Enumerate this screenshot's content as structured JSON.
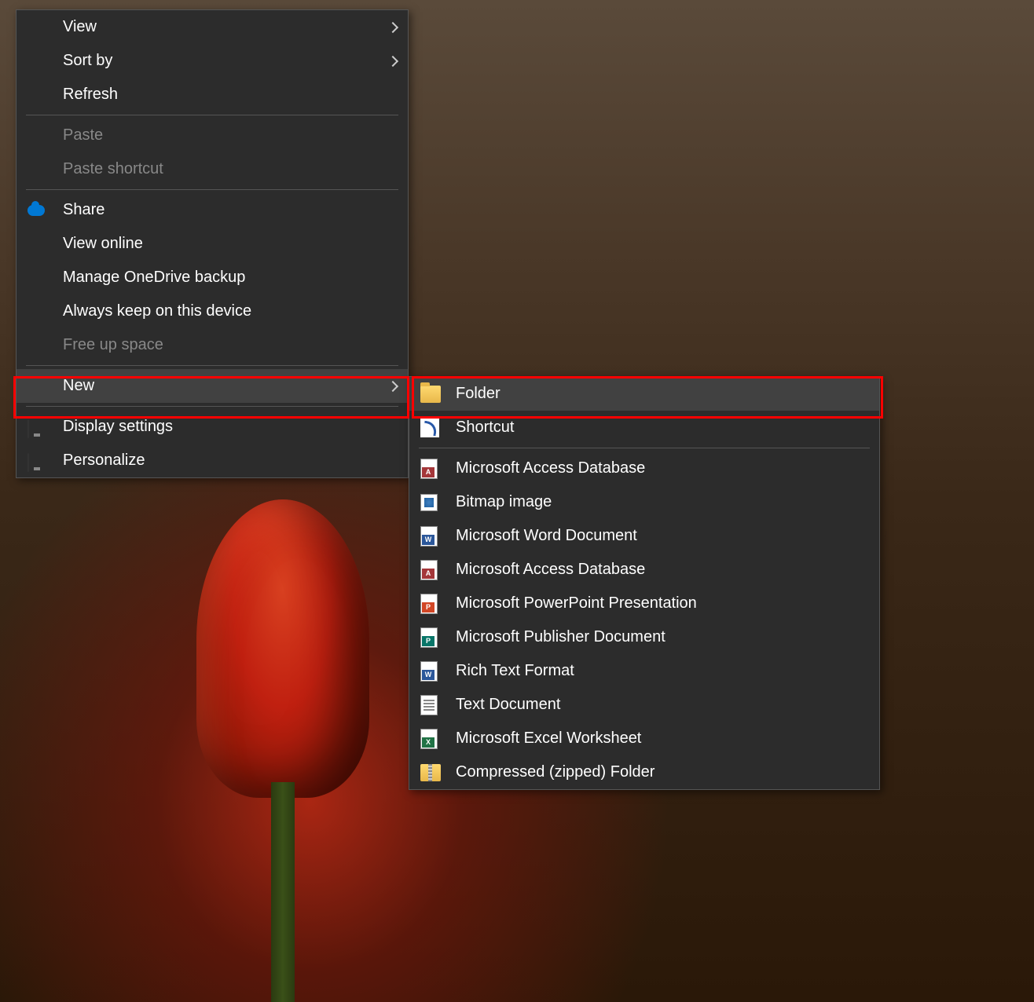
{
  "main_menu": {
    "items": [
      {
        "label": "View",
        "has_submenu": true,
        "disabled": false
      },
      {
        "label": "Sort by",
        "has_submenu": true,
        "disabled": false
      },
      {
        "label": "Refresh",
        "has_submenu": false,
        "disabled": false
      }
    ],
    "paste_items": [
      {
        "label": "Paste",
        "disabled": true
      },
      {
        "label": "Paste shortcut",
        "disabled": true
      }
    ],
    "onedrive_items": [
      {
        "label": "Share",
        "icon": "cloud",
        "disabled": false
      },
      {
        "label": "View online",
        "disabled": false
      },
      {
        "label": "Manage OneDrive backup",
        "disabled": false
      },
      {
        "label": "Always keep on this device",
        "disabled": false
      },
      {
        "label": "Free up space",
        "disabled": true
      }
    ],
    "new_item": {
      "label": "New",
      "has_submenu": true,
      "highlighted": true
    },
    "settings_items": [
      {
        "label": "Display settings",
        "icon": "monitor"
      },
      {
        "label": "Personalize",
        "icon": "monitor-colorful"
      }
    ]
  },
  "sub_menu": {
    "folder_item": {
      "label": "Folder",
      "icon": "folder",
      "highlighted": true
    },
    "shortcut_item": {
      "label": "Shortcut",
      "icon": "shortcut"
    },
    "file_types": [
      {
        "label": "Microsoft Access Database",
        "icon": "access"
      },
      {
        "label": "Bitmap image",
        "icon": "bitmap"
      },
      {
        "label": "Microsoft Word Document",
        "icon": "word"
      },
      {
        "label": "Microsoft Access Database",
        "icon": "access2"
      },
      {
        "label": "Microsoft PowerPoint Presentation",
        "icon": "ppt"
      },
      {
        "label": "Microsoft Publisher Document",
        "icon": "pub"
      },
      {
        "label": "Rich Text Format",
        "icon": "rtf"
      },
      {
        "label": "Text Document",
        "icon": "text"
      },
      {
        "label": "Microsoft Excel Worksheet",
        "icon": "excel"
      },
      {
        "label": "Compressed (zipped) Folder",
        "icon": "zip"
      }
    ]
  }
}
